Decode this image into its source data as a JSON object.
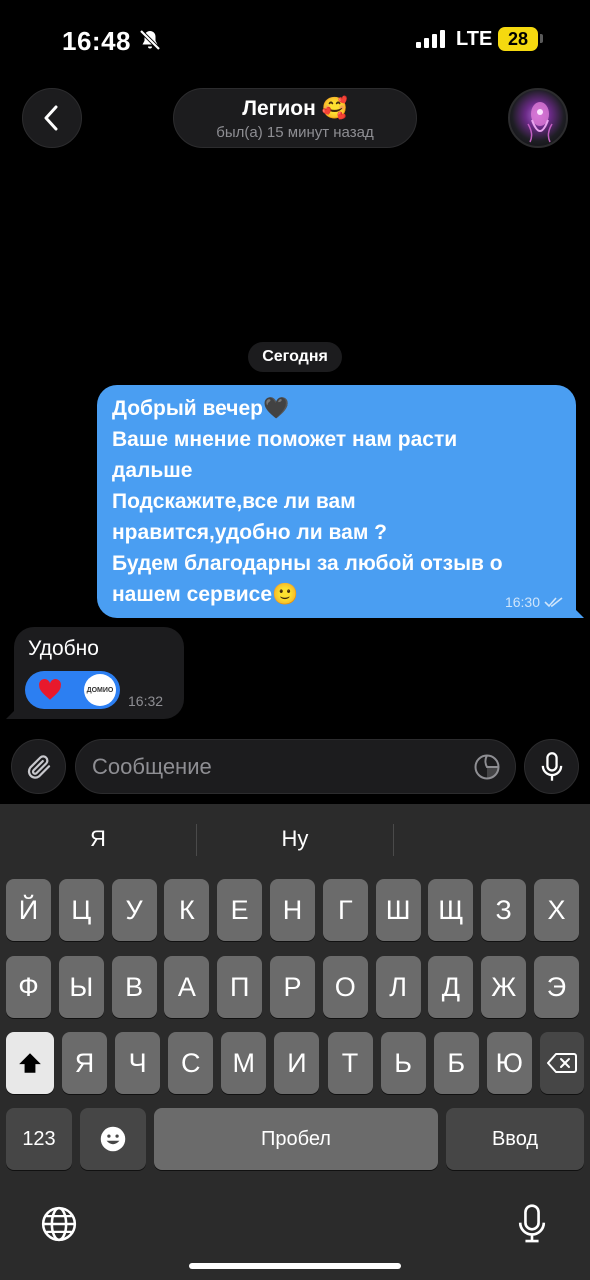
{
  "status_bar": {
    "time": "16:48",
    "network": "LTE",
    "battery": "28"
  },
  "header": {
    "contact_name": "Легион 🥰",
    "contact_status": "был(а) 15 минут назад"
  },
  "chat": {
    "date_label": "Сегодня",
    "outgoing": {
      "lines": [
        "Добрый вечер🖤",
        "Ваше мнение поможет нам расти",
        "дальше",
        "Подскажите,все ли вам",
        "нравится,удобно ли вам ?",
        "Будем благодарны за любой отзыв о",
        "нашем сервисе🙂"
      ],
      "time": "16:30"
    },
    "incoming": {
      "text": "Удобно",
      "reaction_label": "ДОМИО",
      "time": "16:32"
    }
  },
  "composer": {
    "placeholder": "Сообщение"
  },
  "keyboard": {
    "suggestions": [
      "Я",
      "Ну",
      ""
    ],
    "row1": [
      "Й",
      "Ц",
      "У",
      "К",
      "Е",
      "Н",
      "Г",
      "Ш",
      "Щ",
      "З",
      "Х"
    ],
    "row2": [
      "Ф",
      "Ы",
      "В",
      "А",
      "П",
      "Р",
      "О",
      "Л",
      "Д",
      "Ж",
      "Э"
    ],
    "row3": [
      "Я",
      "Ч",
      "С",
      "М",
      "И",
      "Т",
      "Ь",
      "Б",
      "Ю"
    ],
    "numbers_key": "123",
    "space_key": "Пробел",
    "return_key": "Ввод"
  },
  "icons": {
    "back": "chevron-left-icon",
    "bell": "bell-slash-icon",
    "attach": "paperclip-icon",
    "sticker": "sticker-icon",
    "mic": "microphone-icon",
    "shift": "shift-icon",
    "backspace": "backspace-icon",
    "emoji": "emoji-icon",
    "globe": "globe-icon",
    "dictation": "microphone-icon"
  },
  "colors": {
    "outgoing_bubble": "#4a9ef2",
    "incoming_bubble": "#1c1c1e",
    "reaction": "#2c7ff2",
    "battery": "#f5d90f"
  }
}
